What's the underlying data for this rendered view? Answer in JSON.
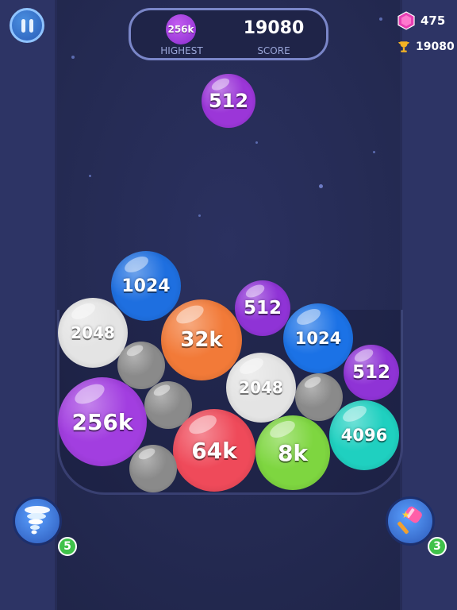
{
  "hud": {
    "highest_value": "256k",
    "highest_label": "HIGHEST",
    "score_value": "19080",
    "score_label": "SCORE",
    "gems": "475",
    "best_score": "19080"
  },
  "next_ball": {
    "label": "512",
    "color": "#9b36d8"
  },
  "balls": [
    {
      "label": "1024",
      "color": "#1e6fe0"
    },
    {
      "label": "512",
      "color": "#8f33d6"
    },
    {
      "label": "2048",
      "color": "#e4e4e4"
    },
    {
      "label": "32k",
      "color": "#f27a38"
    },
    {
      "label": "1024",
      "color": "#1b72e6"
    },
    {
      "label": "512",
      "color": "#8f33d6"
    },
    {
      "label": "",
      "color": "#8a8a8a"
    },
    {
      "label": "2048",
      "color": "#e4e4e4"
    },
    {
      "label": "",
      "color": "#8a8a8a"
    },
    {
      "label": "",
      "color": "#8a8a8a"
    },
    {
      "label": "256k",
      "color": "#a23ee0"
    },
    {
      "label": "4096",
      "color": "#1fd0c0"
    },
    {
      "label": "64k",
      "color": "#ef4a5a"
    },
    {
      "label": "8k",
      "color": "#7ed640"
    },
    {
      "label": "",
      "color": "#8a8a8a"
    }
  ],
  "powerups": {
    "tornado_count": "5",
    "hammer_count": "3"
  }
}
